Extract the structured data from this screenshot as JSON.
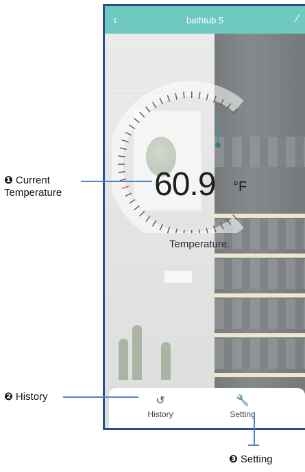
{
  "header": {
    "title": "bathtub 5",
    "back_icon": "chevron-left-icon",
    "edit_icon": "pencil-icon"
  },
  "reading": {
    "value": "60.9",
    "unit": "°F",
    "label": "Temperature."
  },
  "tabs": [
    {
      "label": "History",
      "icon": "history-icon"
    },
    {
      "label": "Setting",
      "icon": "wrench-icon"
    }
  ],
  "annotations": [
    {
      "number": "❶",
      "line1": "Current",
      "line2": "Temperature"
    },
    {
      "number": "❷",
      "text": "History"
    },
    {
      "number": "❸",
      "text": "Setting"
    }
  ],
  "colors": {
    "header": "#6fc9c0",
    "frame": "#2a4f8f",
    "callout_line": "#4c86c8"
  }
}
